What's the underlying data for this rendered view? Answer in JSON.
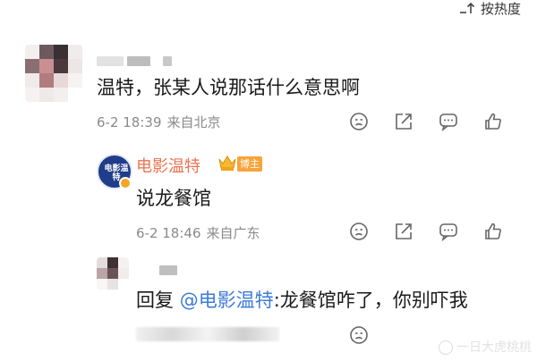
{
  "sort": {
    "label": "按热度",
    "icon": "sort-icon"
  },
  "comments": [
    {
      "username_visible": false,
      "text": "温特，张某人说那话什么意思啊",
      "date_time": "6-2 18:39",
      "location": "来自北京"
    }
  ],
  "reply": {
    "username": "电影温特",
    "badge": "博主",
    "avatar_text": "电影温特",
    "text": "说龙餐馆",
    "date_time": "6-2 18:46",
    "location": "来自广东"
  },
  "nested_reply": {
    "prefix": "回复 ",
    "mention": "@电影温特",
    "text": ":龙餐馆咋了，你别吓我"
  },
  "watermark": "一日大虎桃桃",
  "colors": {
    "name_orange": "#eb7350",
    "mention_blue": "#3c7bd6",
    "badge_orange": "#f7a43a",
    "meta_gray": "#8a8a8a"
  }
}
